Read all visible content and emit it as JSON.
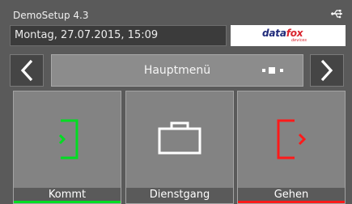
{
  "header": {
    "app_title": "DemoSetup 4.3",
    "datetime": "Montag, 27.07.2015, 15:09",
    "status_icon": "usb-icon",
    "logo": {
      "name": "datafox",
      "word_part1": "data",
      "word_part2": "fox",
      "tagline": "devices"
    }
  },
  "nav": {
    "prev_icon": "chevron-left-icon",
    "next_icon": "chevron-right-icon",
    "menu_title": "Hauptmenü",
    "page_indicator": "page-dots"
  },
  "tiles": [
    {
      "label": "Kommt",
      "icon": "enter-icon",
      "color": "#00dd22"
    },
    {
      "label": "Dienstgang",
      "icon": "briefcase-icon",
      "color": "#ffffff"
    },
    {
      "label": "Gehen",
      "icon": "exit-icon",
      "color": "#ff1a1a"
    }
  ],
  "colors": {
    "background": "#5a5a5a",
    "tile": "#838383",
    "kommt": "#00dd22",
    "gehen": "#ff1a1a",
    "logo_blue": "#1f2a7a",
    "logo_red": "#d9232d"
  }
}
